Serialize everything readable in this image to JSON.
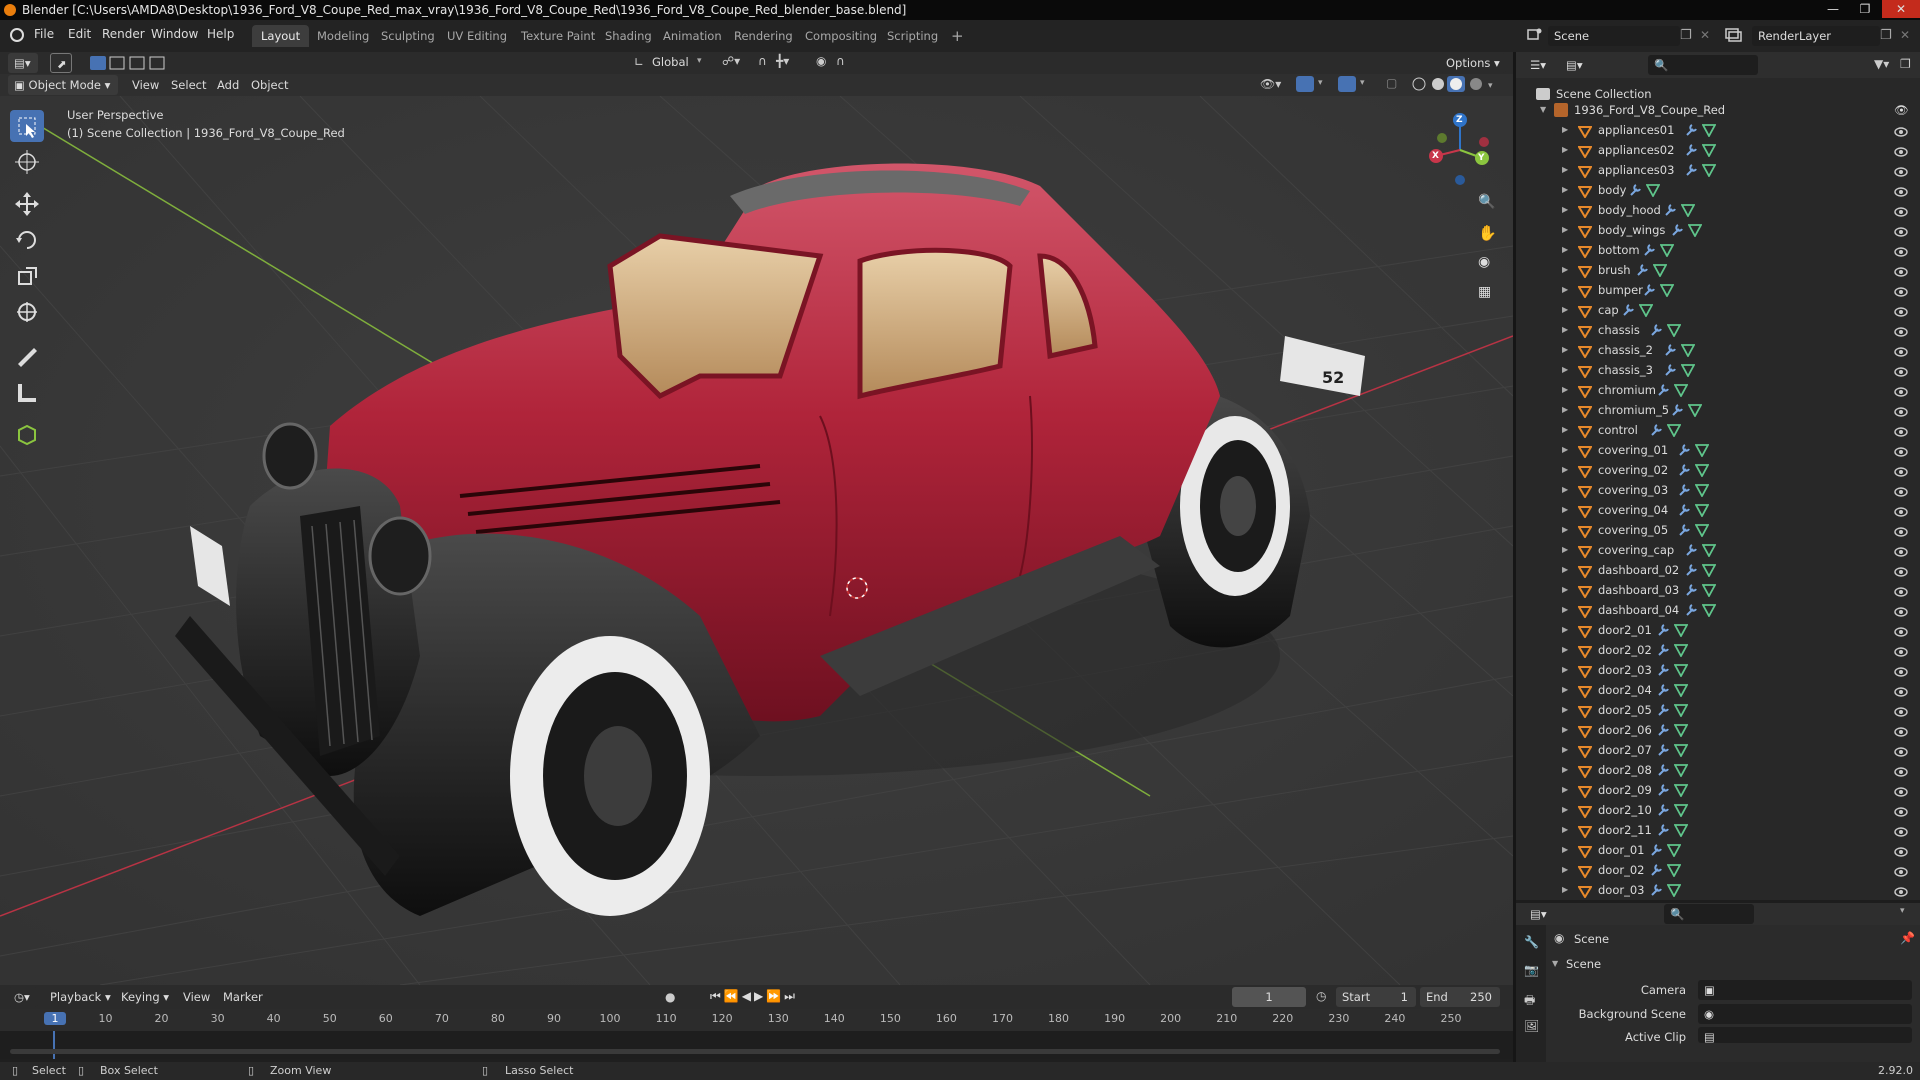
{
  "window": {
    "title": "Blender [C:\\Users\\AMDA8\\Desktop\\1936_Ford_V8_Coupe_Red_max_vray\\1936_Ford_V8_Coupe_Red\\1936_Ford_V8_Coupe_Red_blender_base.blend]"
  },
  "menu": [
    "File",
    "Edit",
    "Render",
    "Window",
    "Help"
  ],
  "workspaces": {
    "tabs": [
      "Layout",
      "Modeling",
      "Sculpting",
      "UV Editing",
      "Texture Paint",
      "Shading",
      "Animation",
      "Rendering",
      "Compositing",
      "Scripting"
    ],
    "active": "Layout",
    "add": "+"
  },
  "scene_selector": {
    "name": "Scene"
  },
  "view_layer": {
    "name": "RenderLayer"
  },
  "viewport_header": {
    "transform_orientation": "Global",
    "options": "Options",
    "mode": "Object Mode",
    "menus": [
      "View",
      "Select",
      "Add",
      "Object"
    ]
  },
  "viewport": {
    "perspective": "User Perspective",
    "collection_info": "(1) Scene Collection | 1936_Ford_V8_Coupe_Red",
    "gizmo": {
      "x": "X",
      "y": "Y",
      "z": "Z"
    },
    "plate_text": "52"
  },
  "outliner": {
    "root": "Scene Collection",
    "collection": "1936_Ford_V8_Coupe_Red",
    "objects": [
      "appliances01",
      "appliances02",
      "appliances03",
      "body",
      "body_hood",
      "body_wings",
      "bottom",
      "brush",
      "bumper",
      "cap",
      "chassis",
      "chassis_2",
      "chassis_3",
      "chromium",
      "chromium_5",
      "control",
      "covering_01",
      "covering_02",
      "covering_03",
      "covering_04",
      "covering_05",
      "covering_cap",
      "dashboard_02",
      "dashboard_03",
      "dashboard_04",
      "door2_01",
      "door2_02",
      "door2_03",
      "door2_04",
      "door2_05",
      "door2_06",
      "door2_07",
      "door2_08",
      "door2_09",
      "door2_10",
      "door2_11",
      "door_01",
      "door_02",
      "door_03"
    ]
  },
  "properties": {
    "context": "Scene",
    "panel": "Scene",
    "fields": [
      "Camera",
      "Background Scene",
      "Active Clip"
    ]
  },
  "timeline": {
    "menus": [
      "Playback",
      "Keying",
      "View",
      "Marker"
    ],
    "current_frame": "1",
    "start_label": "Start",
    "start": "1",
    "end_label": "End",
    "end": "250",
    "ticks": [
      "1",
      "10",
      "20",
      "30",
      "40",
      "50",
      "60",
      "70",
      "80",
      "90",
      "100",
      "110",
      "120",
      "130",
      "140",
      "150",
      "160",
      "170",
      "180",
      "190",
      "200",
      "210",
      "220",
      "230",
      "240",
      "250"
    ]
  },
  "statusbar": {
    "items": [
      "Select",
      "Box Select",
      "Zoom View",
      "Lasso Select"
    ],
    "version": "2.92.0"
  },
  "colors": {
    "accent": "#4772b3",
    "car_body": "#b0243a",
    "x_axis": "#c8364a",
    "y_axis": "#8bc53f",
    "z_axis": "#2f74c9"
  }
}
